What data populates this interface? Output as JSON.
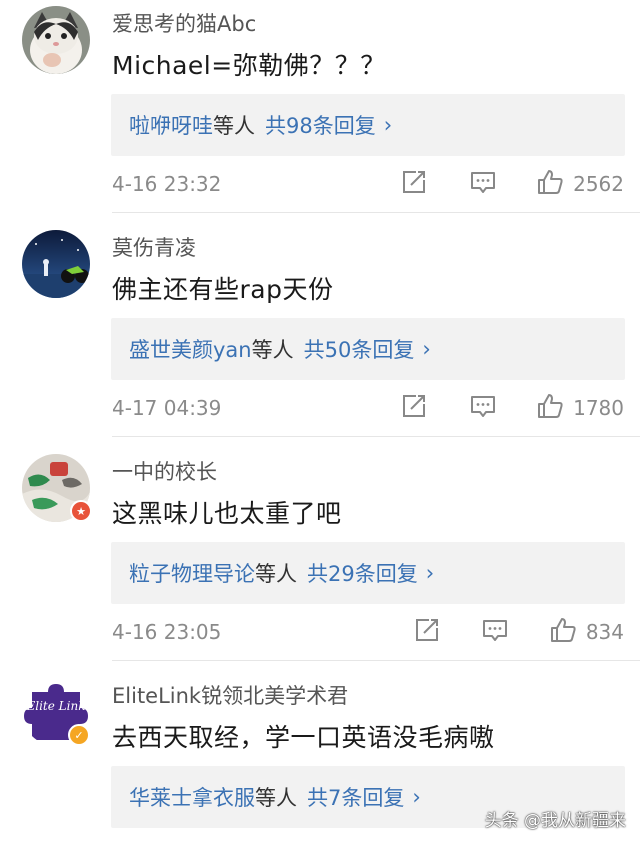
{
  "comments": [
    {
      "username": "爱思考的猫Abc",
      "text": "Michael=弥勒佛？？？",
      "reply_names": "啦咿呀哇",
      "reply_mid": "等人",
      "reply_count": "共98条回复",
      "time": "4-16 23:32",
      "likes": "2562"
    },
    {
      "username": "莫伤青凌",
      "text": "佛主还有些rap天份",
      "reply_names": "盛世美颜yan",
      "reply_mid": "等人",
      "reply_count": "共50条回复",
      "time": "4-17 04:39",
      "likes": "1780"
    },
    {
      "username": "一中的校长",
      "text": "这黑味儿也太重了吧",
      "reply_names": "粒子物理导论",
      "reply_mid": "等人",
      "reply_count": "共29条回复",
      "time": "4-16 23:05",
      "likes": "834"
    },
    {
      "username": "EliteLink锐领北美学术君",
      "text": "去西天取经，学一口英语没毛病嗷",
      "reply_names": "华莱士拿衣服",
      "reply_mid": "等人",
      "reply_count": "共7条回复",
      "avatar_logo": "Elite Link"
    }
  ],
  "reply_chevron": "›",
  "watermark": "头条 @我从新疆来",
  "colors": {
    "link_blue": "#3b72b4",
    "meta_gray": "#8a8a8a",
    "reply_bg": "#f2f2f2",
    "verified_badge": "#f5a623",
    "school_badge": "#e8533a"
  },
  "icons": [
    "repost-icon",
    "comment-icon",
    "like-icon",
    "chevron-right-icon"
  ]
}
